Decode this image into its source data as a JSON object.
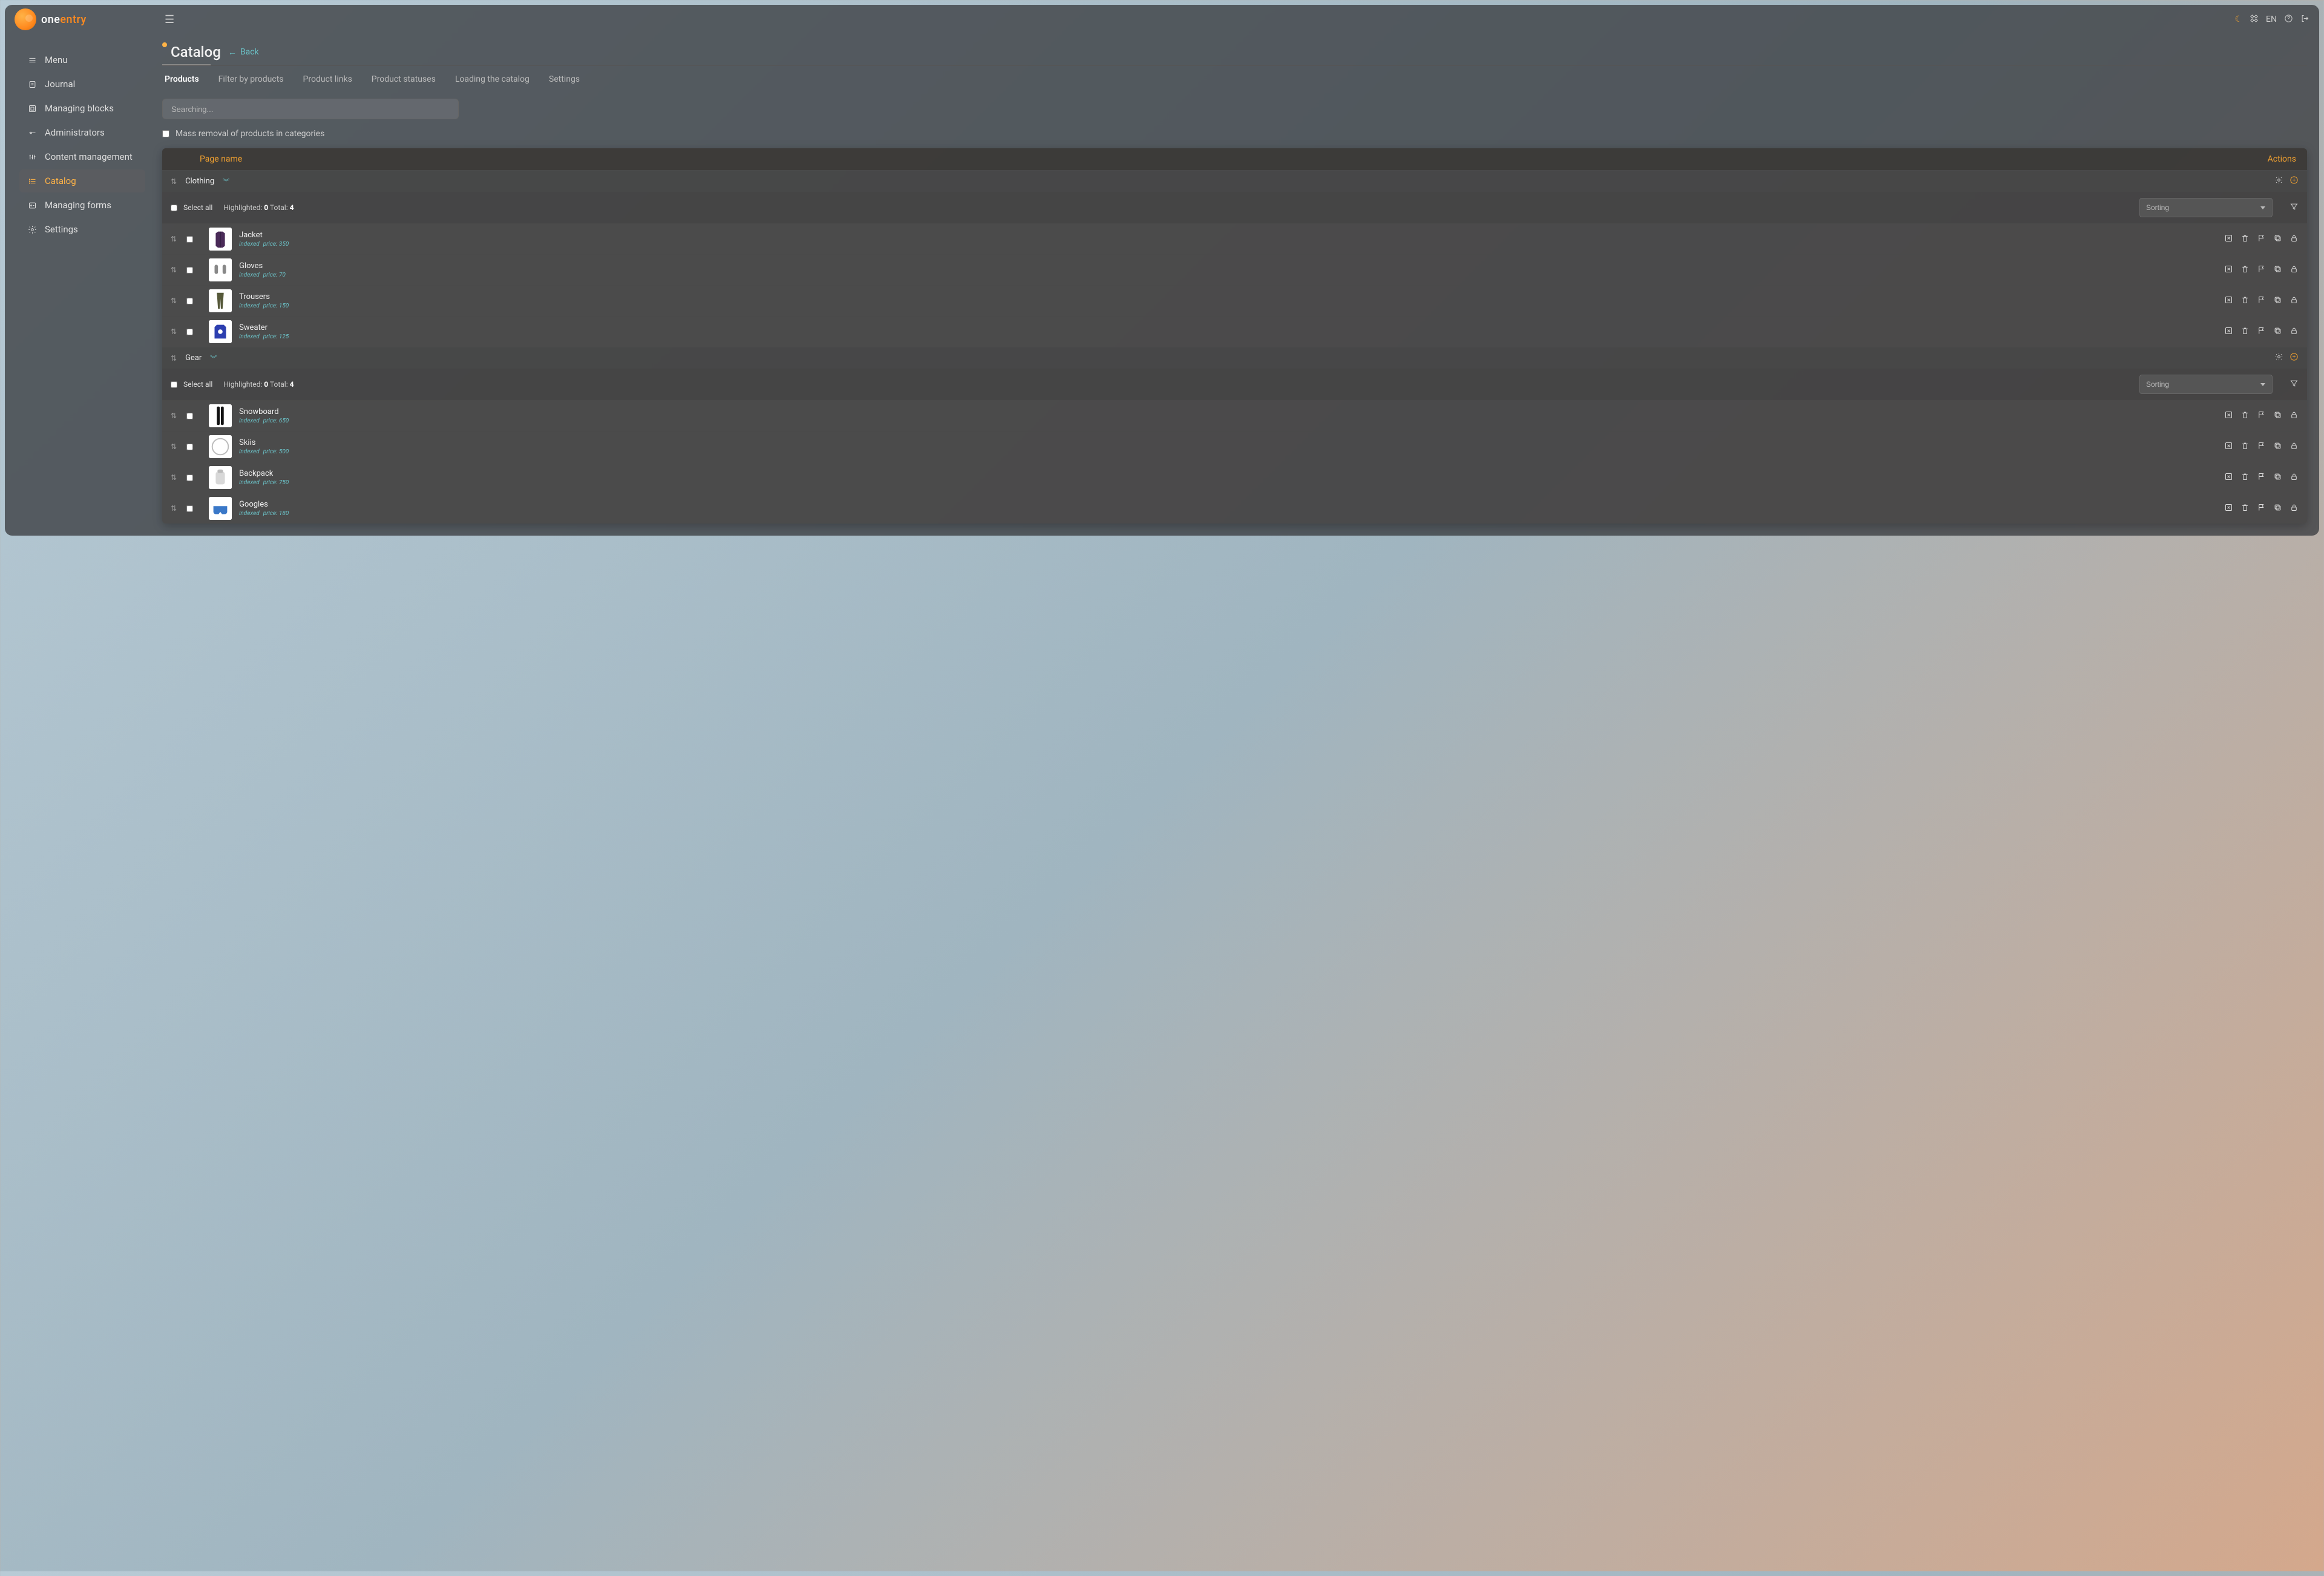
{
  "brand": {
    "part1": "one",
    "part2": "entry"
  },
  "topbar": {
    "lang": "EN"
  },
  "sidebar": [
    {
      "key": "menu",
      "label": "Menu"
    },
    {
      "key": "journal",
      "label": "Journal"
    },
    {
      "key": "blocks",
      "label": "Managing blocks"
    },
    {
      "key": "admins",
      "label": "Administrators"
    },
    {
      "key": "content",
      "label": "Content management"
    },
    {
      "key": "catalog",
      "label": "Catalog",
      "active": true
    },
    {
      "key": "forms",
      "label": "Managing forms"
    },
    {
      "key": "settings",
      "label": "Settings"
    }
  ],
  "page": {
    "title": "Catalog",
    "back": "Back"
  },
  "tabs": [
    {
      "label": "Products",
      "active": true
    },
    {
      "label": "Filter by products"
    },
    {
      "label": "Product links"
    },
    {
      "label": "Product statuses"
    },
    {
      "label": "Loading the catalog"
    },
    {
      "label": "Settings"
    }
  ],
  "search": {
    "placeholder": "Searching..."
  },
  "massRemoval": {
    "label": "Mass removal of products in categories"
  },
  "panel": {
    "colName": "Page name",
    "colActions": "Actions"
  },
  "selection": {
    "selectAll": "Select all",
    "highlighted": "Highlighted:",
    "total": "Total:"
  },
  "sorting": {
    "placeholder": "Sorting"
  },
  "indexedLabel": "indexed",
  "priceLabel": "price:",
  "categories": [
    {
      "name": "Clothing",
      "highlighted": 0,
      "total": 4,
      "products": [
        {
          "name": "Jacket",
          "price": 350,
          "thumb": "jacket"
        },
        {
          "name": "Gloves",
          "price": 70,
          "thumb": "gloves"
        },
        {
          "name": "Trousers",
          "price": 150,
          "thumb": "trousers"
        },
        {
          "name": "Sweater",
          "price": 125,
          "thumb": "sweater"
        }
      ]
    },
    {
      "name": "Gear",
      "highlighted": 0,
      "total": 4,
      "products": [
        {
          "name": "Snowboard",
          "price": 650,
          "thumb": "snowboard"
        },
        {
          "name": "Skiis",
          "price": 500,
          "thumb": "skiis"
        },
        {
          "name": "Backpack",
          "price": 750,
          "thumb": "backpack"
        },
        {
          "name": "Googles",
          "price": 180,
          "thumb": "goggles"
        }
      ]
    }
  ]
}
